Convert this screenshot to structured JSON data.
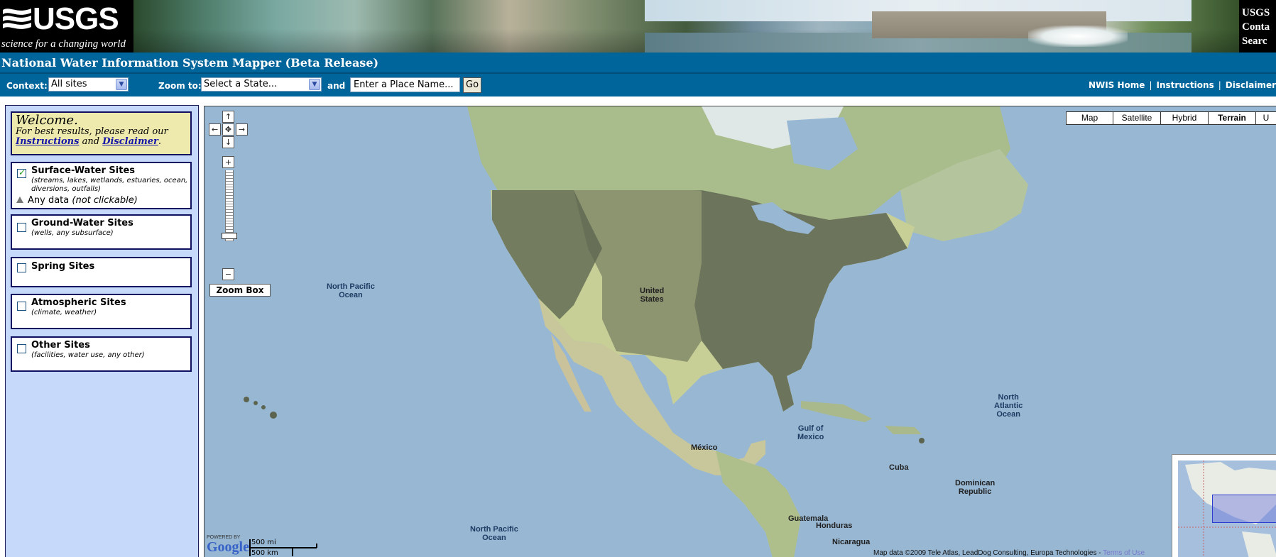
{
  "banner": {
    "logo_word": "USGS",
    "logo_tagline": "science for a changing world",
    "right_links": [
      "USGS",
      "Conta",
      "Searc"
    ]
  },
  "app_title": "National Water Information System Mapper (Beta Release)",
  "context_bar": {
    "context_label": "Context:",
    "context_value": "All sites",
    "zoom_label": "Zoom to:",
    "state_value": "Select a State...",
    "and_label": "and",
    "place_placeholder": "Enter a Place Name...",
    "go_label": "Go",
    "links": [
      "NWIS Home",
      "Instructions",
      "Disclaimer"
    ]
  },
  "sidebar": {
    "welcome": {
      "heading": "Welcome.",
      "text_before": "For best results, please read our",
      "link_instructions": "Instructions",
      "and": "and",
      "link_disclaimer": "Disclaimer",
      "period": "."
    },
    "sites": [
      {
        "name": "Surface-Water Sites",
        "desc": "(streams, lakes, wetlands, estuaries, ocean, diversions, outfalls)",
        "checked": true,
        "legend": "Any data",
        "legend_note": "(not clickable)"
      },
      {
        "name": "Ground-Water Sites",
        "desc": "(wells, any subsurface)",
        "checked": false
      },
      {
        "name": "Spring Sites",
        "desc": "",
        "checked": false
      },
      {
        "name": "Atmospheric Sites",
        "desc": "(climate, weather)",
        "checked": false
      },
      {
        "name": "Other Sites",
        "desc": "(facilities, water use, any other)",
        "checked": false
      }
    ]
  },
  "map": {
    "controls": {
      "pan_up": "↑",
      "pan_left": "←",
      "pan_center": "✥",
      "pan_right": "→",
      "pan_down": "↓",
      "zoom_in": "+",
      "zoom_out": "−",
      "zoom_box": "Zoom Box"
    },
    "types": [
      "Map",
      "Satellite",
      "Hybrid",
      "Terrain",
      "U"
    ],
    "selected_type": "Terrain",
    "labels": {
      "north_pacific_1": "North Pacific\nOcean",
      "united_states": "United\nStates",
      "north_atlantic": "North\nAtlantic\nOcean",
      "gulf_mexico": "Gulf of\nMexico",
      "mexico": "México",
      "cuba": "Cuba",
      "dominican": "Dominican\nRepublic",
      "guatemala": "Guatemala",
      "honduras": "Honduras",
      "nicaragua": "Nicaragua",
      "north_pacific_2": "North Pacific\nOcean"
    },
    "scale": {
      "mi": "500 mi",
      "km": "500 km"
    },
    "google_powered": "POWERED BY",
    "google_word": "Google",
    "attribution": "Map data ©2009 Tele Atlas, LeadDog Consulting, Europa Technologies - ",
    "terms": "Terms of Use"
  },
  "colors": {
    "usgs_blue": "#00659a",
    "sidebar_bg": "#c6d9fb",
    "welcome_bg": "#eeeaae",
    "water": "#98b7d3",
    "site_dots": "#5c6450"
  }
}
